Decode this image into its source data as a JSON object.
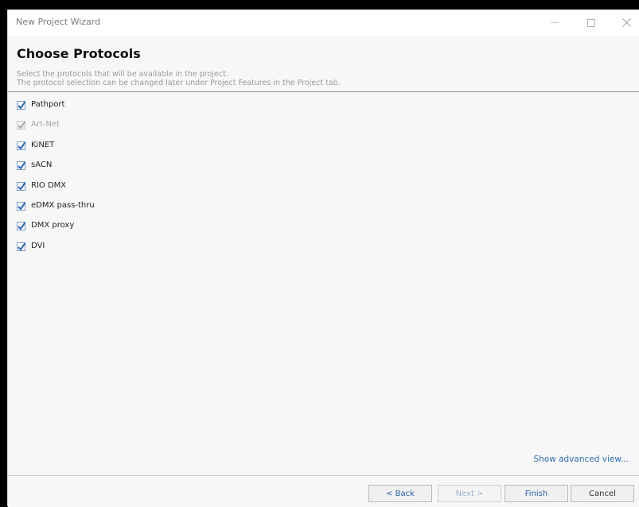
{
  "window": {
    "title": "New Project Wizard"
  },
  "header": {
    "title": "Choose Protocols",
    "description_line1": "Select the protocols that will be available in the project.",
    "description_line2": "The protocol selection can be changed later under Project Features in the Project tab."
  },
  "protocols": [
    {
      "label": "Pathport",
      "checked": true,
      "enabled": true
    },
    {
      "label": "Art-Net",
      "checked": true,
      "enabled": false
    },
    {
      "label": "KiNET",
      "checked": true,
      "enabled": true
    },
    {
      "label": "sACN",
      "checked": true,
      "enabled": true
    },
    {
      "label": "RIO DMX",
      "checked": true,
      "enabled": true
    },
    {
      "label": "eDMX pass-thru",
      "checked": true,
      "enabled": true
    },
    {
      "label": "DMX proxy",
      "checked": true,
      "enabled": true
    },
    {
      "label": "DVI",
      "checked": true,
      "enabled": true
    }
  ],
  "advanced_link": "Show advanced view...",
  "buttons": {
    "back": "< Back",
    "next": "Next >",
    "finish": "Finish",
    "cancel": "Cancel"
  },
  "icons": {
    "check": "checkmark-icon",
    "minimize": "minimize-icon",
    "maximize": "maximize-icon",
    "close": "close-icon"
  },
  "colors": {
    "link": "#2f6fb5",
    "checkmark": "#2f68b4",
    "checkmark_disabled": "#a8a8a8"
  }
}
